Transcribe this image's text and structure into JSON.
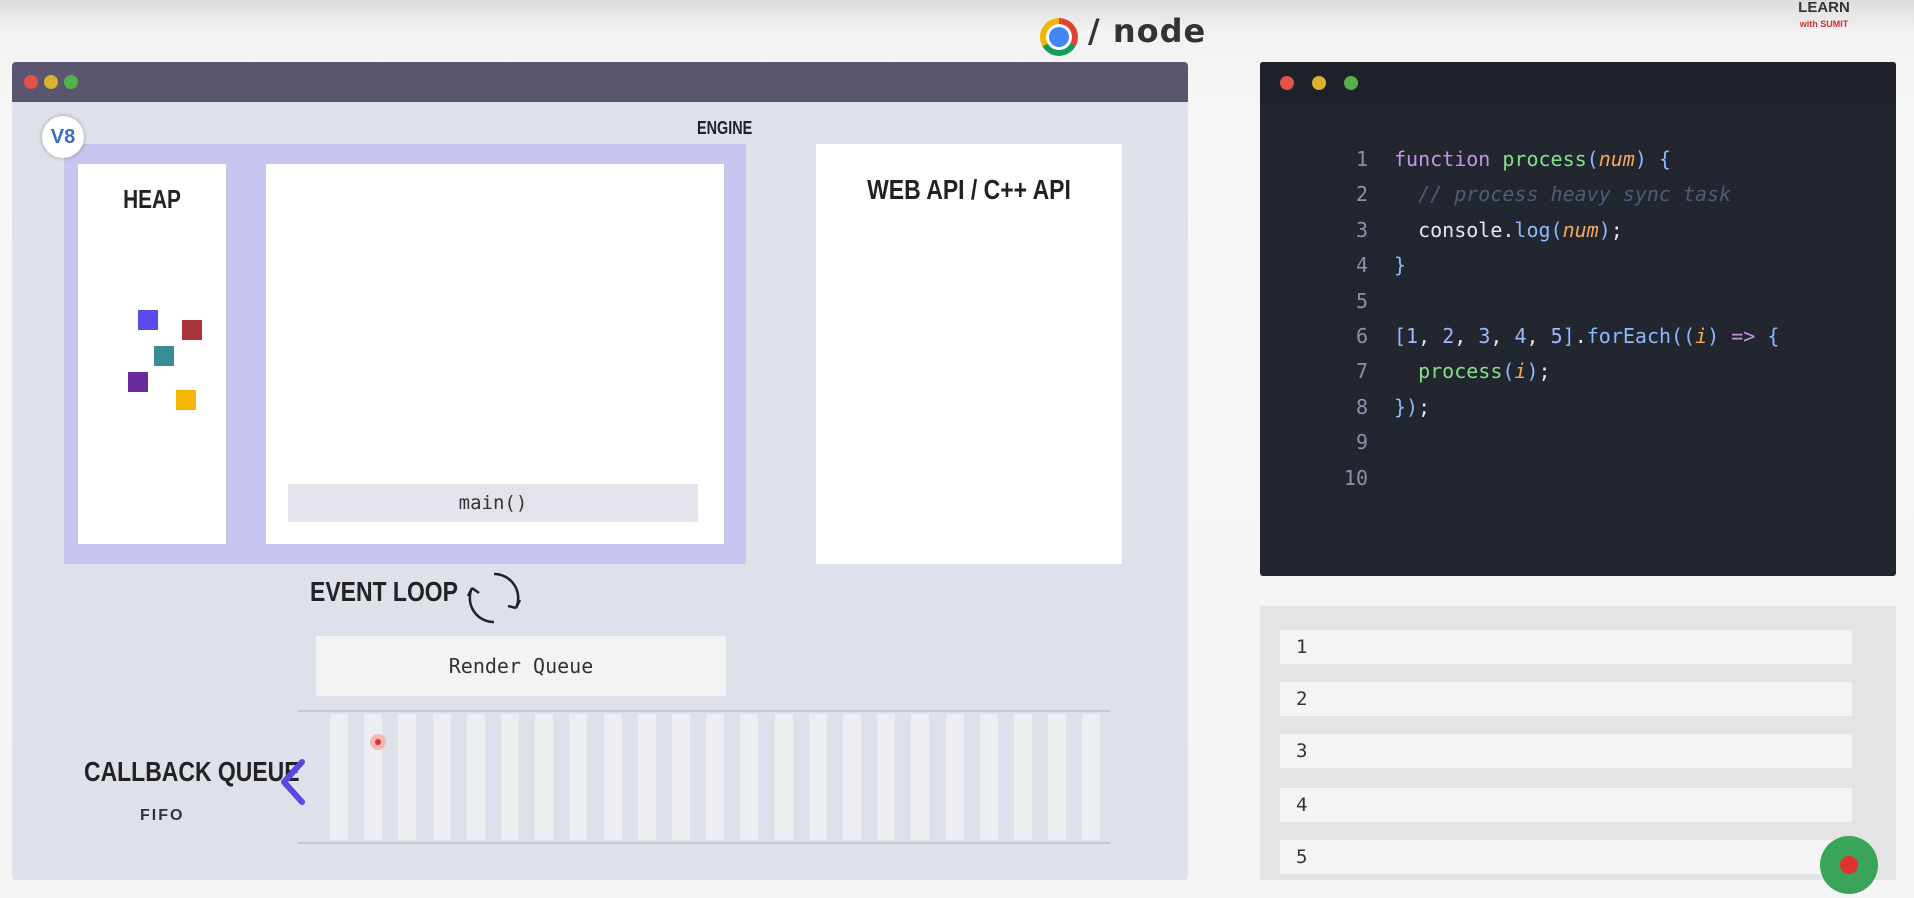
{
  "header": {
    "node_logo": "node",
    "learn_logo": {
      "line1": "LEARN",
      "line2": "with SUMIT"
    }
  },
  "left_window": {
    "engine_label": "ENGINE",
    "v8_badge": "V8",
    "heap": {
      "title": "HEAP",
      "objects": [
        "#5b4cf0",
        "#a8343a",
        "#3a8c96",
        "#6a2b9c",
        "#f5b700"
      ]
    },
    "call_stack": {
      "frames": [
        "main()"
      ]
    },
    "web_api": {
      "title": "WEB API / C++ API"
    },
    "event_loop": {
      "label": "EVENT LOOP"
    },
    "render_queue": {
      "label": "Render Queue"
    },
    "callback_queue": {
      "title": "CALLBACK QUEUE",
      "subtitle": "FIFO"
    }
  },
  "code_editor": {
    "lines": [
      {
        "n": "1",
        "tokens": [
          [
            "kw",
            "function "
          ],
          [
            "fn",
            "process"
          ],
          [
            "pn",
            "("
          ],
          [
            "param",
            "num"
          ],
          [
            "pn",
            ") {"
          ]
        ]
      },
      {
        "n": "2",
        "tokens": [
          [
            "cm",
            "  // process heavy sync task"
          ]
        ]
      },
      {
        "n": "3",
        "tokens": [
          [
            "tx",
            "  console."
          ],
          [
            "pn",
            "log("
          ],
          [
            "param",
            "num"
          ],
          [
            "pn",
            ")"
          ],
          [
            "tx",
            ";"
          ]
        ]
      },
      {
        "n": "4",
        "tokens": [
          [
            "pn",
            "}"
          ]
        ]
      },
      {
        "n": "5",
        "tokens": []
      },
      {
        "n": "6",
        "tokens": [
          [
            "pn",
            "["
          ],
          [
            "num",
            "1"
          ],
          [
            "tx",
            ", "
          ],
          [
            "num",
            "2"
          ],
          [
            "tx",
            ", "
          ],
          [
            "num",
            "3"
          ],
          [
            "tx",
            ", "
          ],
          [
            "num",
            "4"
          ],
          [
            "tx",
            ", "
          ],
          [
            "num",
            "5"
          ],
          [
            "pn",
            "]"
          ],
          [
            "tx",
            "."
          ],
          [
            "pn",
            "forEach(("
          ],
          [
            "param",
            "i"
          ],
          [
            "pn",
            ") "
          ],
          [
            "op",
            "=>"
          ],
          [
            "pn",
            " {"
          ]
        ]
      },
      {
        "n": "7",
        "tokens": [
          [
            "fn",
            "  process"
          ],
          [
            "pn",
            "("
          ],
          [
            "param",
            "i"
          ],
          [
            "pn",
            ")"
          ],
          [
            "tx",
            ";"
          ]
        ]
      },
      {
        "n": "8",
        "tokens": [
          [
            "pn",
            "})"
          ],
          [
            "tx",
            ";"
          ]
        ]
      },
      {
        "n": "9",
        "tokens": []
      },
      {
        "n": "10",
        "tokens": []
      }
    ]
  },
  "console": {
    "rows": [
      "1",
      "2",
      "3",
      "4",
      "5"
    ]
  }
}
